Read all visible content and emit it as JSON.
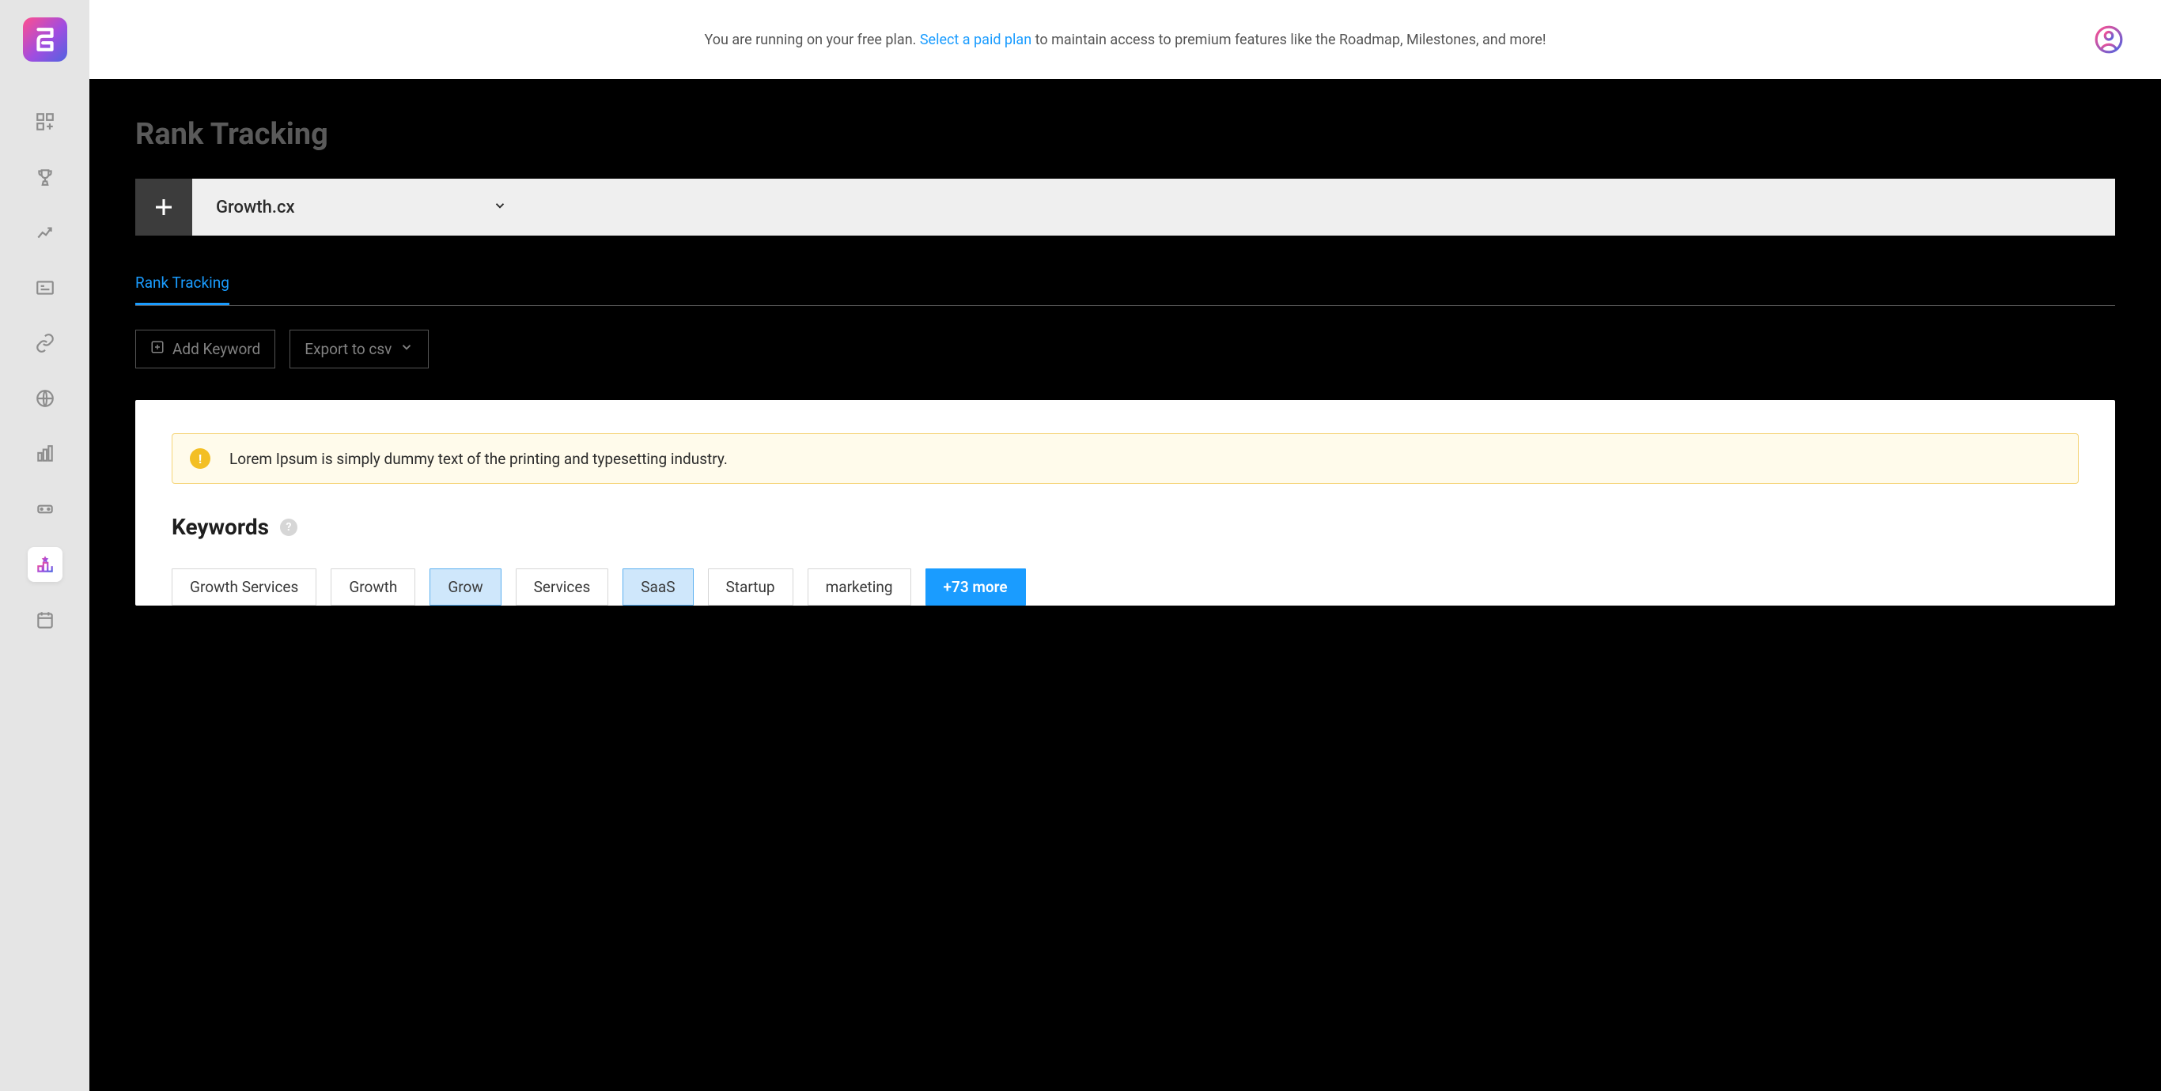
{
  "banner": {
    "prefix": "You are running on your free plan. ",
    "link": "Select a paid plan",
    "suffix": " to maintain access to premium features like the Roadmap, Milestones, and more!"
  },
  "sidebar": {
    "items": [
      {
        "name": "dashboard"
      },
      {
        "name": "achievements"
      },
      {
        "name": "analytics"
      },
      {
        "name": "content"
      },
      {
        "name": "links"
      },
      {
        "name": "web"
      },
      {
        "name": "performance"
      },
      {
        "name": "api"
      },
      {
        "name": "rank-tracking"
      },
      {
        "name": "calendar"
      }
    ],
    "active_index": 8
  },
  "page": {
    "title": "Rank Tracking",
    "project": "Growth.cx",
    "tab": "Rank Tracking"
  },
  "toolbar": {
    "add_keyword": "Add Keyword",
    "export": "Export to csv"
  },
  "alert": {
    "text": "Lorem Ipsum is simply dummy text of the printing and typesetting industry."
  },
  "keywords": {
    "heading": "Keywords",
    "chips": [
      {
        "label": "Growth Services",
        "selected": false
      },
      {
        "label": "Growth",
        "selected": false
      },
      {
        "label": "Grow",
        "selected": true
      },
      {
        "label": "Services",
        "selected": false
      },
      {
        "label": "SaaS",
        "selected": true
      },
      {
        "label": "Startup",
        "selected": false
      },
      {
        "label": "marketing",
        "selected": false
      }
    ],
    "more": "+73 more"
  }
}
